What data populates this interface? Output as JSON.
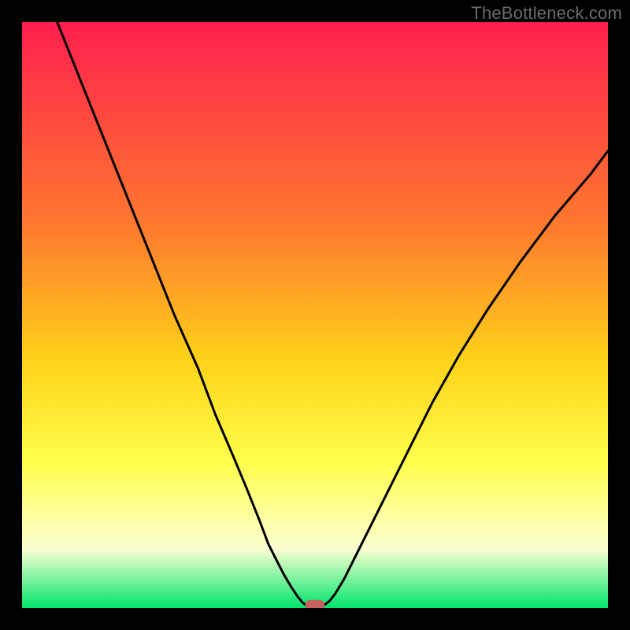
{
  "watermark": "TheBottleneck.com",
  "colors": {
    "frame": "#000000",
    "watermark": "#6a6a6a",
    "gradient_top": "#ff1f4e",
    "gradient_mid1": "#ff7a2e",
    "gradient_mid2": "#ffd31a",
    "gradient_mid3": "#ffff4a",
    "gradient_mid4": "#fbffd2",
    "gradient_bottom": "#00e56a",
    "curve": "#000000",
    "marker_fill": "#c46262",
    "marker_stroke": "#c46262"
  },
  "chart_data": {
    "type": "line",
    "title": "",
    "xlabel": "",
    "ylabel": "",
    "xlim": [
      0,
      100
    ],
    "ylim": [
      0,
      100
    ],
    "series": [
      {
        "name": "left-curve",
        "x": [
          6,
          10,
          14,
          18,
          22,
          26,
          30,
          33,
          36,
          38.5,
          40.5,
          42,
          43.5,
          44.8,
          46,
          47,
          47.8,
          48.4
        ],
        "values": [
          100,
          90,
          80,
          70,
          60,
          50,
          41,
          33,
          26,
          20,
          15,
          11,
          8,
          5.5,
          3.5,
          2,
          1,
          0.5
        ]
      },
      {
        "name": "right-curve",
        "x": [
          51.6,
          52.5,
          53.5,
          55,
          57,
          59.5,
          62.5,
          66,
          70,
          74.5,
          79.5,
          85,
          91,
          97,
          100
        ],
        "values": [
          0.5,
          1.2,
          2.5,
          5,
          9,
          14,
          20,
          27,
          35,
          43,
          51,
          59,
          67,
          74,
          78
        ]
      }
    ],
    "marker": {
      "name": "bottleneck-marker",
      "x_center": 50,
      "width": 3.2,
      "y": 0.5
    },
    "gradient_stops": [
      {
        "offset": 0,
        "color": "#ff1f4e"
      },
      {
        "offset": 35,
        "color": "#ff7a2e"
      },
      {
        "offset": 58,
        "color": "#ffd31a"
      },
      {
        "offset": 75,
        "color": "#ffff4a"
      },
      {
        "offset": 90,
        "color": "#fbffd2"
      },
      {
        "offset": 100,
        "color": "#00e56a"
      }
    ]
  }
}
